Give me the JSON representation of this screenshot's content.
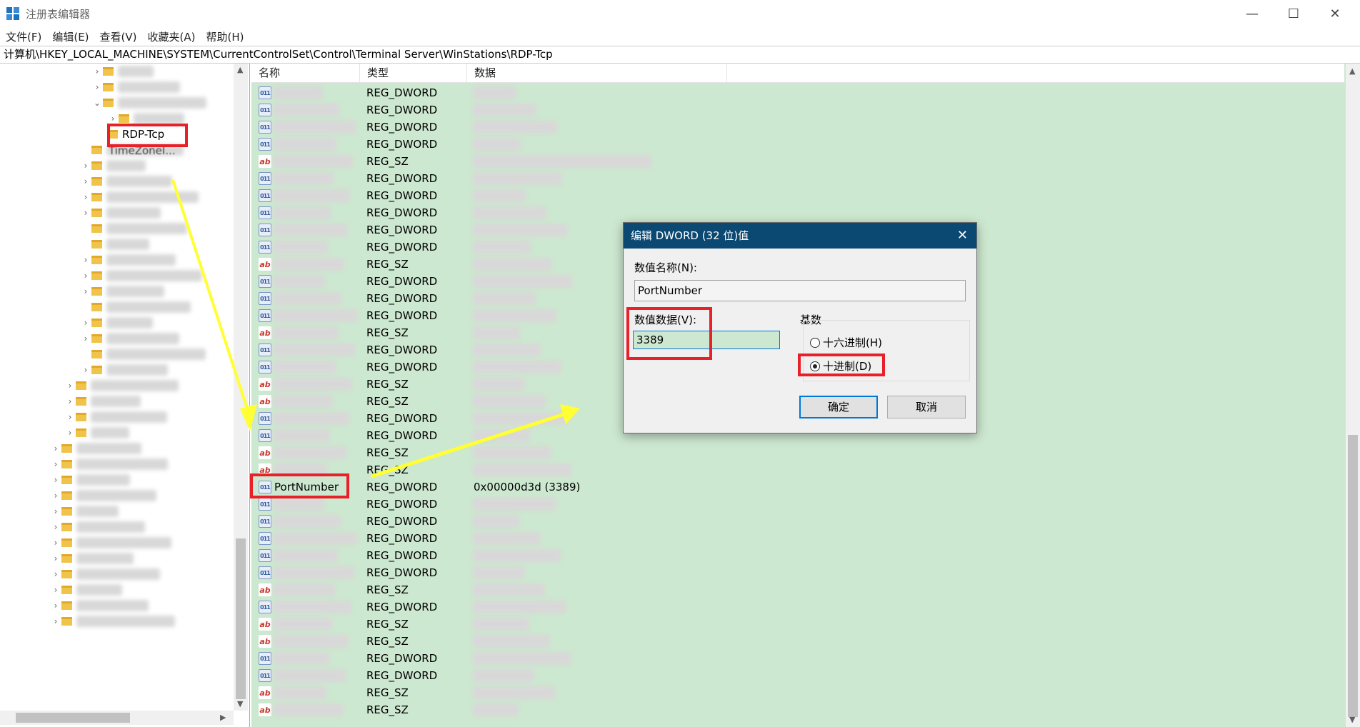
{
  "window": {
    "title": "注册表编辑器",
    "minimize": "—",
    "maximize": "☐",
    "close": "✕"
  },
  "menu": [
    "文件(F)",
    "编辑(E)",
    "查看(V)",
    "收藏夹(A)",
    "帮助(H)"
  ],
  "address": "计算机\\HKEY_LOCAL_MACHINE\\SYSTEM\\CurrentControlSet\\Control\\Terminal Server\\WinStations\\RDP-Tcp",
  "tree": {
    "selected_key": "RDP-Tcp",
    "partial_key": "TimeZoneI..."
  },
  "list": {
    "columns": {
      "name": "名称",
      "type": "类型",
      "data": "数据"
    },
    "rows": [
      {
        "kind": "dword",
        "type": "REG_DWORD"
      },
      {
        "kind": "dword",
        "type": "REG_DWORD"
      },
      {
        "kind": "dword",
        "type": "REG_DWORD"
      },
      {
        "kind": "dword",
        "type": "REG_DWORD"
      },
      {
        "kind": "sz",
        "type": "REG_SZ"
      },
      {
        "kind": "dword",
        "type": "REG_DWORD"
      },
      {
        "kind": "dword",
        "type": "REG_DWORD"
      },
      {
        "kind": "dword",
        "type": "REG_DWORD"
      },
      {
        "kind": "dword",
        "type": "REG_DWORD"
      },
      {
        "kind": "dword",
        "type": "REG_DWORD"
      },
      {
        "kind": "sz",
        "type": "REG_SZ"
      },
      {
        "kind": "dword",
        "type": "REG_DWORD"
      },
      {
        "kind": "dword",
        "type": "REG_DWORD"
      },
      {
        "kind": "dword",
        "type": "REG_DWORD"
      },
      {
        "kind": "sz",
        "type": "REG_SZ"
      },
      {
        "kind": "dword",
        "type": "REG_DWORD"
      },
      {
        "kind": "dword",
        "type": "REG_DWORD"
      },
      {
        "kind": "sz",
        "type": "REG_SZ"
      },
      {
        "kind": "sz",
        "type": "REG_SZ"
      },
      {
        "kind": "dword",
        "type": "REG_DWORD"
      },
      {
        "kind": "dword",
        "type": "REG_DWORD"
      },
      {
        "kind": "sz",
        "type": "REG_SZ"
      },
      {
        "kind": "sz",
        "type": "REG_SZ"
      },
      {
        "kind": "dword",
        "type": "REG_DWORD",
        "name": "PortNumber",
        "data": "0x00000d3d (3389)"
      },
      {
        "kind": "dword",
        "type": "REG_DWORD"
      },
      {
        "kind": "dword",
        "type": "REG_DWORD"
      },
      {
        "kind": "dword",
        "type": "REG_DWORD"
      },
      {
        "kind": "dword",
        "type": "REG_DWORD"
      },
      {
        "kind": "dword",
        "type": "REG_DWORD"
      },
      {
        "kind": "sz",
        "type": "REG_SZ"
      },
      {
        "kind": "dword",
        "type": "REG_DWORD"
      },
      {
        "kind": "sz",
        "type": "REG_SZ"
      },
      {
        "kind": "sz",
        "type": "REG_SZ"
      },
      {
        "kind": "dword",
        "type": "REG_DWORD"
      },
      {
        "kind": "dword",
        "type": "REG_DWORD"
      },
      {
        "kind": "sz",
        "type": "REG_SZ"
      },
      {
        "kind": "sz",
        "type": "REG_SZ"
      }
    ]
  },
  "dialog": {
    "title": "编辑 DWORD (32 位)值",
    "close": "✕",
    "value_name_label": "数值名称(N):",
    "value_name": "PortNumber",
    "value_data_label": "数值数据(V):",
    "value_data": "3389",
    "base_label": "基数",
    "hex_label": "十六进制(H)",
    "dec_label": "十进制(D)",
    "selected_base": "decimal",
    "ok": "确定",
    "cancel": "取消"
  },
  "colors": {
    "highlight": "#e8202a",
    "arrow": "#ffff33",
    "list_background": "#cde8d0",
    "dialog_titlebar": "#0b4872"
  }
}
